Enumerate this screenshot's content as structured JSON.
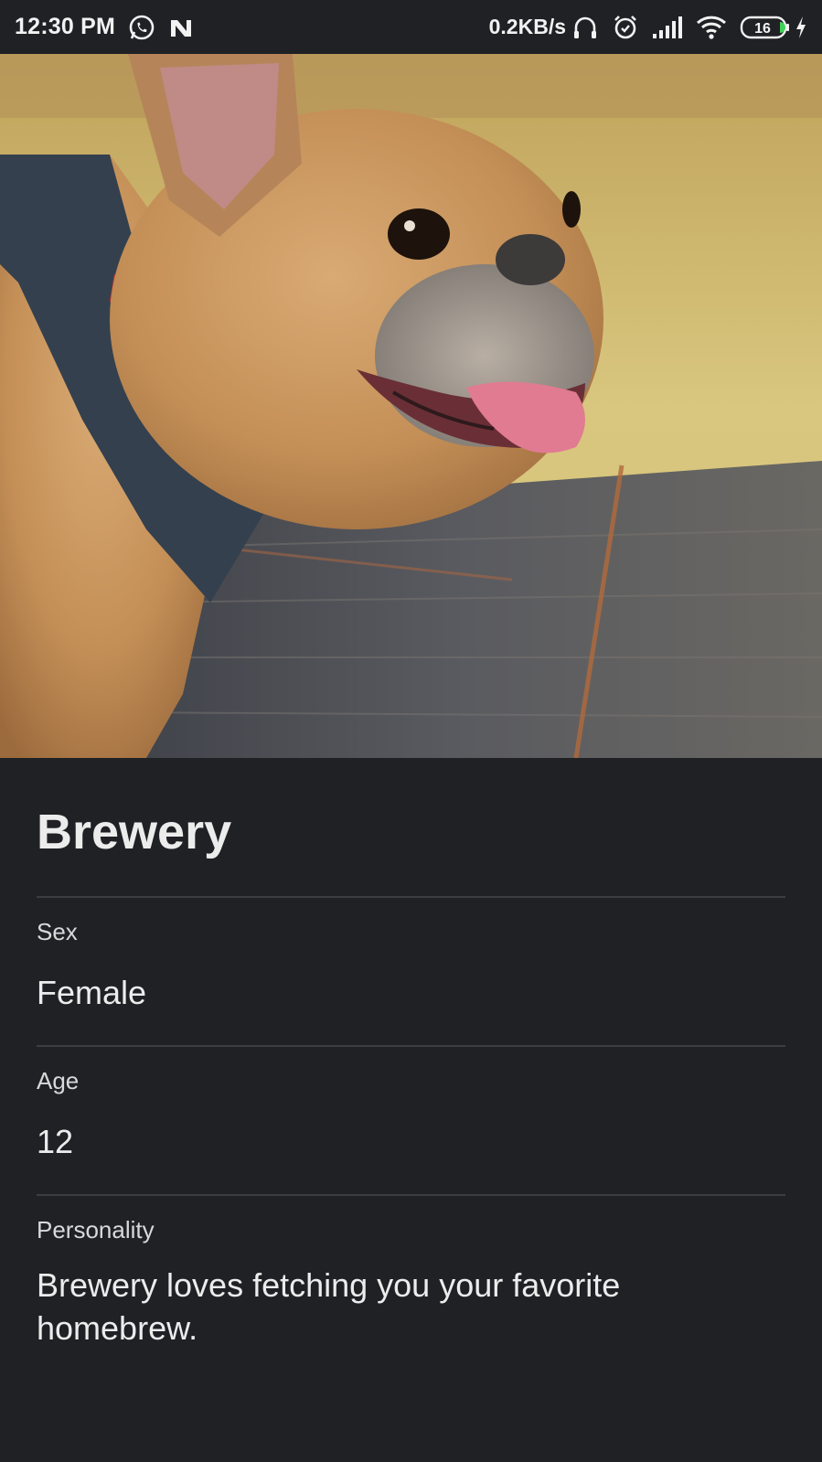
{
  "status_bar": {
    "time": "12:30 PM",
    "net_speed": "0.2KB/s",
    "battery": "16",
    "icons": [
      "whatsapp-icon",
      "n-notification-icon",
      "headphones-icon",
      "alarm-icon",
      "signal-icon",
      "wifi-icon",
      "battery-icon",
      "charging-icon"
    ]
  },
  "pet": {
    "name": "Brewery",
    "fields": [
      {
        "label": "Sex",
        "value": "Female"
      },
      {
        "label": "Age",
        "value": "12"
      },
      {
        "label": "Personality",
        "value": "Brewery loves fetching you your favorite homebrew."
      }
    ]
  },
  "colors": {
    "background": "#202125",
    "divider": "#3c3d42",
    "text": "#ececec"
  }
}
